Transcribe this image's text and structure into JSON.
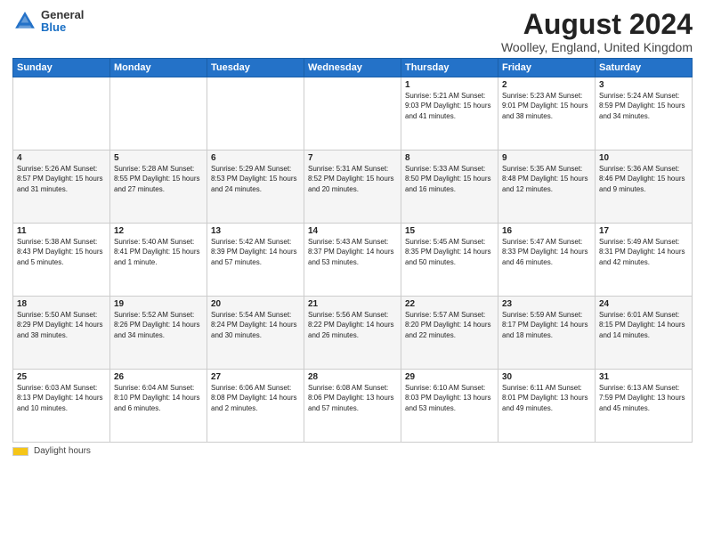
{
  "header": {
    "logo_general": "General",
    "logo_blue": "Blue",
    "title": "August 2024",
    "subtitle": "Woolley, England, United Kingdom"
  },
  "calendar": {
    "days_of_week": [
      "Sunday",
      "Monday",
      "Tuesday",
      "Wednesday",
      "Thursday",
      "Friday",
      "Saturday"
    ],
    "rows": [
      [
        {
          "num": "",
          "info": ""
        },
        {
          "num": "",
          "info": ""
        },
        {
          "num": "",
          "info": ""
        },
        {
          "num": "",
          "info": ""
        },
        {
          "num": "1",
          "info": "Sunrise: 5:21 AM\nSunset: 9:03 PM\nDaylight: 15 hours\nand 41 minutes."
        },
        {
          "num": "2",
          "info": "Sunrise: 5:23 AM\nSunset: 9:01 PM\nDaylight: 15 hours\nand 38 minutes."
        },
        {
          "num": "3",
          "info": "Sunrise: 5:24 AM\nSunset: 8:59 PM\nDaylight: 15 hours\nand 34 minutes."
        }
      ],
      [
        {
          "num": "4",
          "info": "Sunrise: 5:26 AM\nSunset: 8:57 PM\nDaylight: 15 hours\nand 31 minutes."
        },
        {
          "num": "5",
          "info": "Sunrise: 5:28 AM\nSunset: 8:55 PM\nDaylight: 15 hours\nand 27 minutes."
        },
        {
          "num": "6",
          "info": "Sunrise: 5:29 AM\nSunset: 8:53 PM\nDaylight: 15 hours\nand 24 minutes."
        },
        {
          "num": "7",
          "info": "Sunrise: 5:31 AM\nSunset: 8:52 PM\nDaylight: 15 hours\nand 20 minutes."
        },
        {
          "num": "8",
          "info": "Sunrise: 5:33 AM\nSunset: 8:50 PM\nDaylight: 15 hours\nand 16 minutes."
        },
        {
          "num": "9",
          "info": "Sunrise: 5:35 AM\nSunset: 8:48 PM\nDaylight: 15 hours\nand 12 minutes."
        },
        {
          "num": "10",
          "info": "Sunrise: 5:36 AM\nSunset: 8:46 PM\nDaylight: 15 hours\nand 9 minutes."
        }
      ],
      [
        {
          "num": "11",
          "info": "Sunrise: 5:38 AM\nSunset: 8:43 PM\nDaylight: 15 hours\nand 5 minutes."
        },
        {
          "num": "12",
          "info": "Sunrise: 5:40 AM\nSunset: 8:41 PM\nDaylight: 15 hours\nand 1 minute."
        },
        {
          "num": "13",
          "info": "Sunrise: 5:42 AM\nSunset: 8:39 PM\nDaylight: 14 hours\nand 57 minutes."
        },
        {
          "num": "14",
          "info": "Sunrise: 5:43 AM\nSunset: 8:37 PM\nDaylight: 14 hours\nand 53 minutes."
        },
        {
          "num": "15",
          "info": "Sunrise: 5:45 AM\nSunset: 8:35 PM\nDaylight: 14 hours\nand 50 minutes."
        },
        {
          "num": "16",
          "info": "Sunrise: 5:47 AM\nSunset: 8:33 PM\nDaylight: 14 hours\nand 46 minutes."
        },
        {
          "num": "17",
          "info": "Sunrise: 5:49 AM\nSunset: 8:31 PM\nDaylight: 14 hours\nand 42 minutes."
        }
      ],
      [
        {
          "num": "18",
          "info": "Sunrise: 5:50 AM\nSunset: 8:29 PM\nDaylight: 14 hours\nand 38 minutes."
        },
        {
          "num": "19",
          "info": "Sunrise: 5:52 AM\nSunset: 8:26 PM\nDaylight: 14 hours\nand 34 minutes."
        },
        {
          "num": "20",
          "info": "Sunrise: 5:54 AM\nSunset: 8:24 PM\nDaylight: 14 hours\nand 30 minutes."
        },
        {
          "num": "21",
          "info": "Sunrise: 5:56 AM\nSunset: 8:22 PM\nDaylight: 14 hours\nand 26 minutes."
        },
        {
          "num": "22",
          "info": "Sunrise: 5:57 AM\nSunset: 8:20 PM\nDaylight: 14 hours\nand 22 minutes."
        },
        {
          "num": "23",
          "info": "Sunrise: 5:59 AM\nSunset: 8:17 PM\nDaylight: 14 hours\nand 18 minutes."
        },
        {
          "num": "24",
          "info": "Sunrise: 6:01 AM\nSunset: 8:15 PM\nDaylight: 14 hours\nand 14 minutes."
        }
      ],
      [
        {
          "num": "25",
          "info": "Sunrise: 6:03 AM\nSunset: 8:13 PM\nDaylight: 14 hours\nand 10 minutes."
        },
        {
          "num": "26",
          "info": "Sunrise: 6:04 AM\nSunset: 8:10 PM\nDaylight: 14 hours\nand 6 minutes."
        },
        {
          "num": "27",
          "info": "Sunrise: 6:06 AM\nSunset: 8:08 PM\nDaylight: 14 hours\nand 2 minutes."
        },
        {
          "num": "28",
          "info": "Sunrise: 6:08 AM\nSunset: 8:06 PM\nDaylight: 13 hours\nand 57 minutes."
        },
        {
          "num": "29",
          "info": "Sunrise: 6:10 AM\nSunset: 8:03 PM\nDaylight: 13 hours\nand 53 minutes."
        },
        {
          "num": "30",
          "info": "Sunrise: 6:11 AM\nSunset: 8:01 PM\nDaylight: 13 hours\nand 49 minutes."
        },
        {
          "num": "31",
          "info": "Sunrise: 6:13 AM\nSunset: 7:59 PM\nDaylight: 13 hours\nand 45 minutes."
        }
      ]
    ]
  },
  "footer": {
    "daylight_label": "Daylight hours"
  }
}
